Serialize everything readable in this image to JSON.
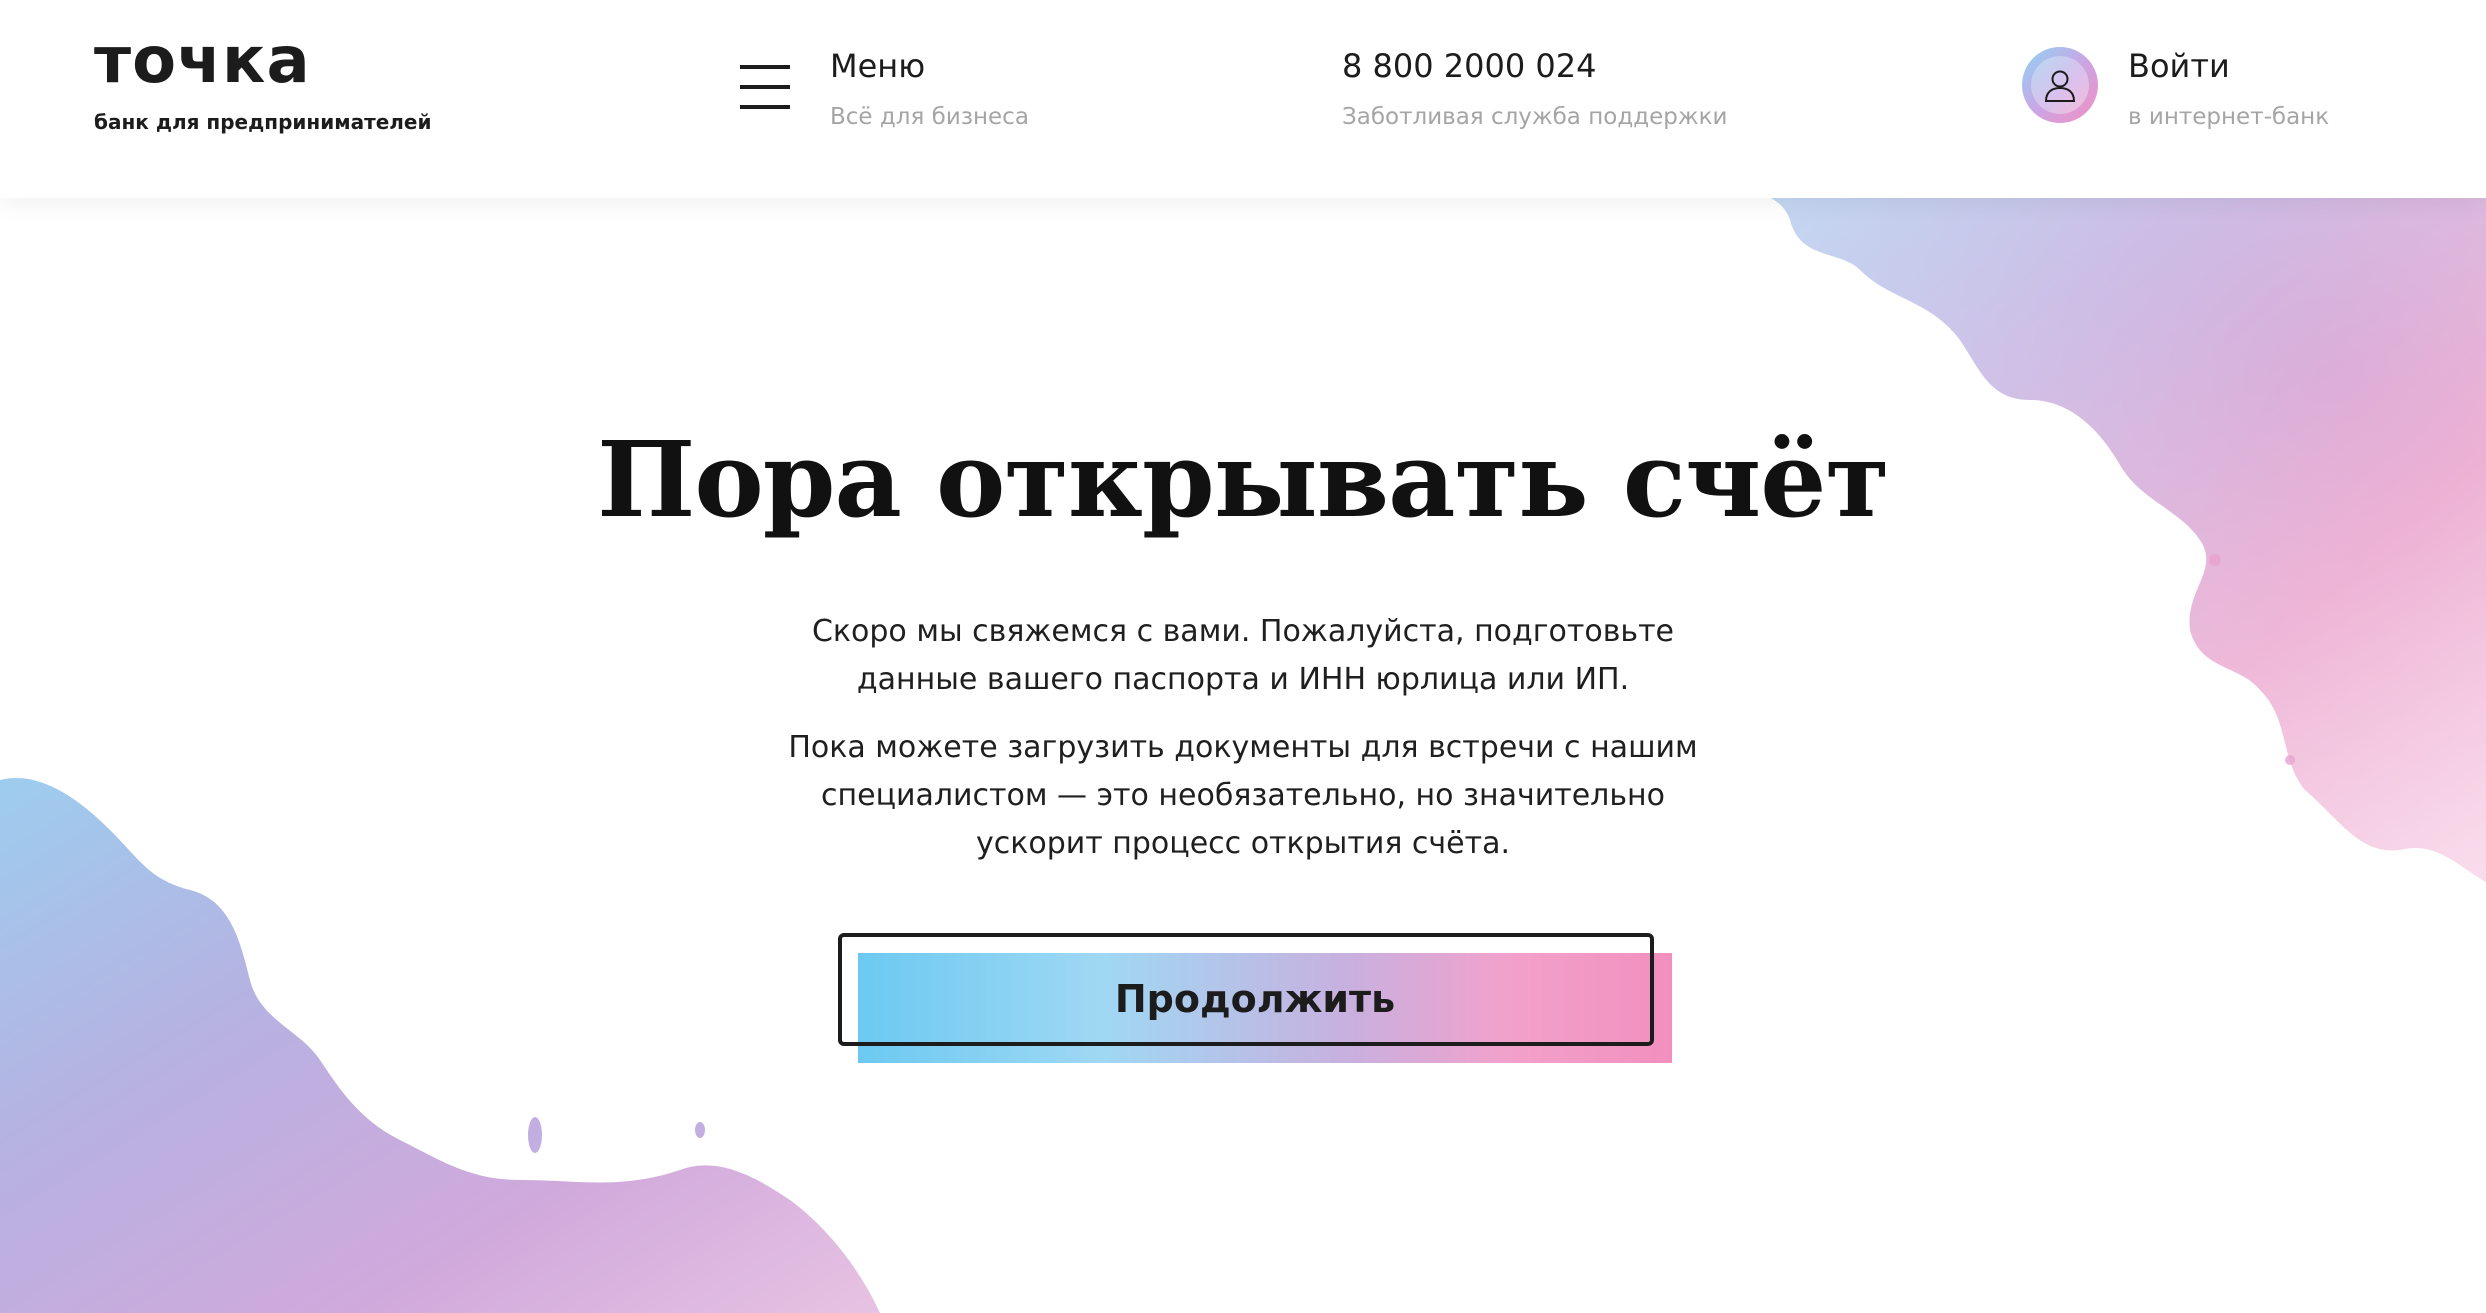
{
  "header": {
    "logo": {
      "wordmark": "точка",
      "tagline": "банк для предпринимателей"
    },
    "menu": {
      "title": "Меню",
      "subtitle": "Всё для бизнеса",
      "icon": "burger-icon"
    },
    "phone": {
      "number": "8 800 2000 024",
      "subtitle": "Заботливая служба поддержки"
    },
    "login": {
      "title": "Войти",
      "subtitle": "в интернет-банк",
      "icon": "user-avatar-icon"
    }
  },
  "hero": {
    "title": "Пора открывать счёт",
    "paragraph_1": "Скоро мы свяжемся с вами. Пожалуйста, подготовьте данные вашего паспорта и ИНН юрлица или ИП.",
    "paragraph_2": "Пока можете загрузить документы для встречи с нашим специалистом — это необязательно, но значительно ускорит процесс открытия счёта."
  },
  "cta": {
    "label": "Продолжить"
  },
  "colors": {
    "text": "#1c1c1c",
    "muted": "#a5a5a5",
    "accent_blue": "#6cc9f2",
    "accent_purple": "#c8b0df",
    "accent_pink": "#f28fbf"
  }
}
